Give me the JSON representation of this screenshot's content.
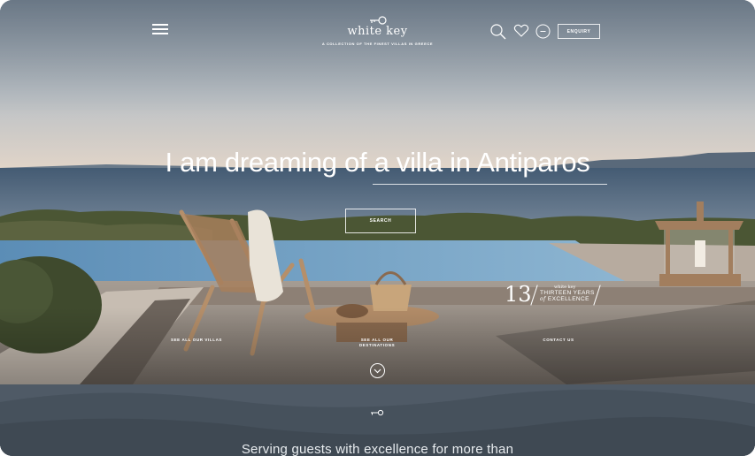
{
  "header": {
    "brand_name": "white key",
    "tagline": "A COLLECTION OF THE FINEST VILLAS IN GREECE",
    "enquiry_label": "ENQUIRY",
    "icons": [
      "menu-icon",
      "search-icon",
      "heart-icon",
      "currency-icon"
    ]
  },
  "hero": {
    "headline": "I am dreaming of a villa in Antiparos",
    "search_label": "SEARCH"
  },
  "badge": {
    "number": "13",
    "brand": "white key",
    "line1": "THIRTEEN YEARS",
    "line2_prefix": "of",
    "line2": "EXCELLENCE"
  },
  "quick_links": {
    "villas": "SEE ALL OUR VILLAS",
    "destinations_1": "SEE ALL OUR",
    "destinations_2": "DESTINATIONS",
    "contact": "CONTACT US"
  },
  "intro": {
    "text": "Serving guests with excellence for more than"
  },
  "colors": {
    "sky_top": "#9aaabb",
    "sky_bottom": "#d9d0c8",
    "sea": "#4c6278",
    "pool": "#6f9ec2",
    "deck": "#9a9088",
    "band": "#4f5a66"
  }
}
